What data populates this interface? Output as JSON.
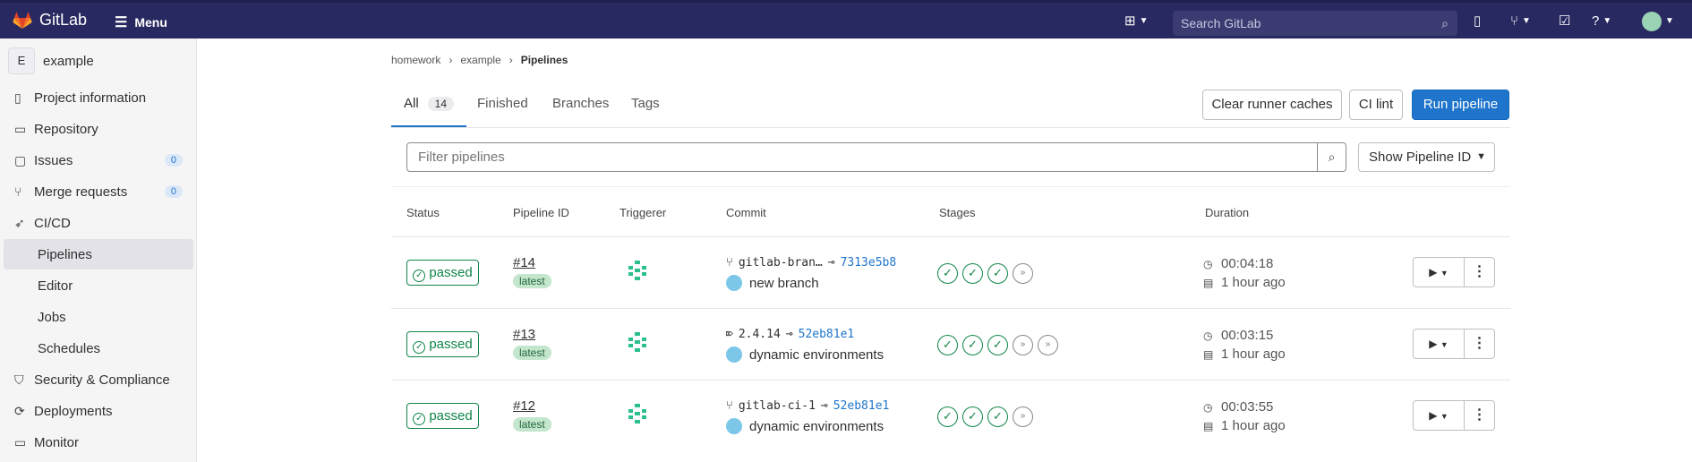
{
  "topbar": {
    "brand": "GitLab",
    "menu_label": "Menu",
    "search_placeholder": "Search GitLab"
  },
  "sidebar": {
    "project_letter": "E",
    "project_name": "example",
    "items": [
      {
        "label": "Project information",
        "icon": "doc-icon"
      },
      {
        "label": "Repository",
        "icon": "repo-icon"
      },
      {
        "label": "Issues",
        "icon": "issues-icon",
        "count": "0"
      },
      {
        "label": "Merge requests",
        "icon": "merge-icon",
        "count": "0"
      },
      {
        "label": "CI/CD",
        "icon": "rocket-icon"
      }
    ],
    "subitems": [
      "Pipelines",
      "Editor",
      "Jobs",
      "Schedules"
    ],
    "items2": [
      {
        "label": "Security & Compliance",
        "icon": "shield-icon"
      },
      {
        "label": "Deployments",
        "icon": "deploy-icon"
      },
      {
        "label": "Monitor",
        "icon": "monitor-icon"
      }
    ]
  },
  "breadcrumb": [
    "homework",
    "example",
    "Pipelines"
  ],
  "tabs": {
    "all": "All",
    "all_count": "14",
    "finished": "Finished",
    "branches": "Branches",
    "tags": "Tags"
  },
  "buttons": {
    "clear_cache": "Clear runner caches",
    "ci_lint": "CI lint",
    "run_pipeline": "Run pipeline"
  },
  "filter": {
    "placeholder": "Filter pipelines",
    "select": "Show Pipeline ID"
  },
  "columns": [
    "Status",
    "Pipeline ID",
    "Triggerer",
    "Commit",
    "Stages",
    "Duration"
  ],
  "pipelines": [
    {
      "status": "passed",
      "id": "#14",
      "tag": "latest",
      "ref_type": "branch",
      "ref": "gitlab-bran…",
      "sha": "7313e5b8",
      "message": "new branch",
      "stages": [
        "passed",
        "passed",
        "passed",
        "skipped"
      ],
      "duration": "00:04:18",
      "finished": "1 hour ago"
    },
    {
      "status": "passed",
      "id": "#13",
      "tag": "latest",
      "ref_type": "tag",
      "ref": "2.4.14",
      "sha": "52eb81e1",
      "message": "dynamic environments",
      "stages": [
        "passed",
        "passed",
        "passed",
        "skipped",
        "skipped"
      ],
      "duration": "00:03:15",
      "finished": "1 hour ago"
    },
    {
      "status": "passed",
      "id": "#12",
      "tag": "latest",
      "ref_type": "branch",
      "ref": "gitlab-ci-1",
      "sha": "52eb81e1",
      "message": "dynamic environments",
      "stages": [
        "passed",
        "passed",
        "passed",
        "skipped"
      ],
      "duration": "00:03:55",
      "finished": "1 hour ago"
    }
  ]
}
